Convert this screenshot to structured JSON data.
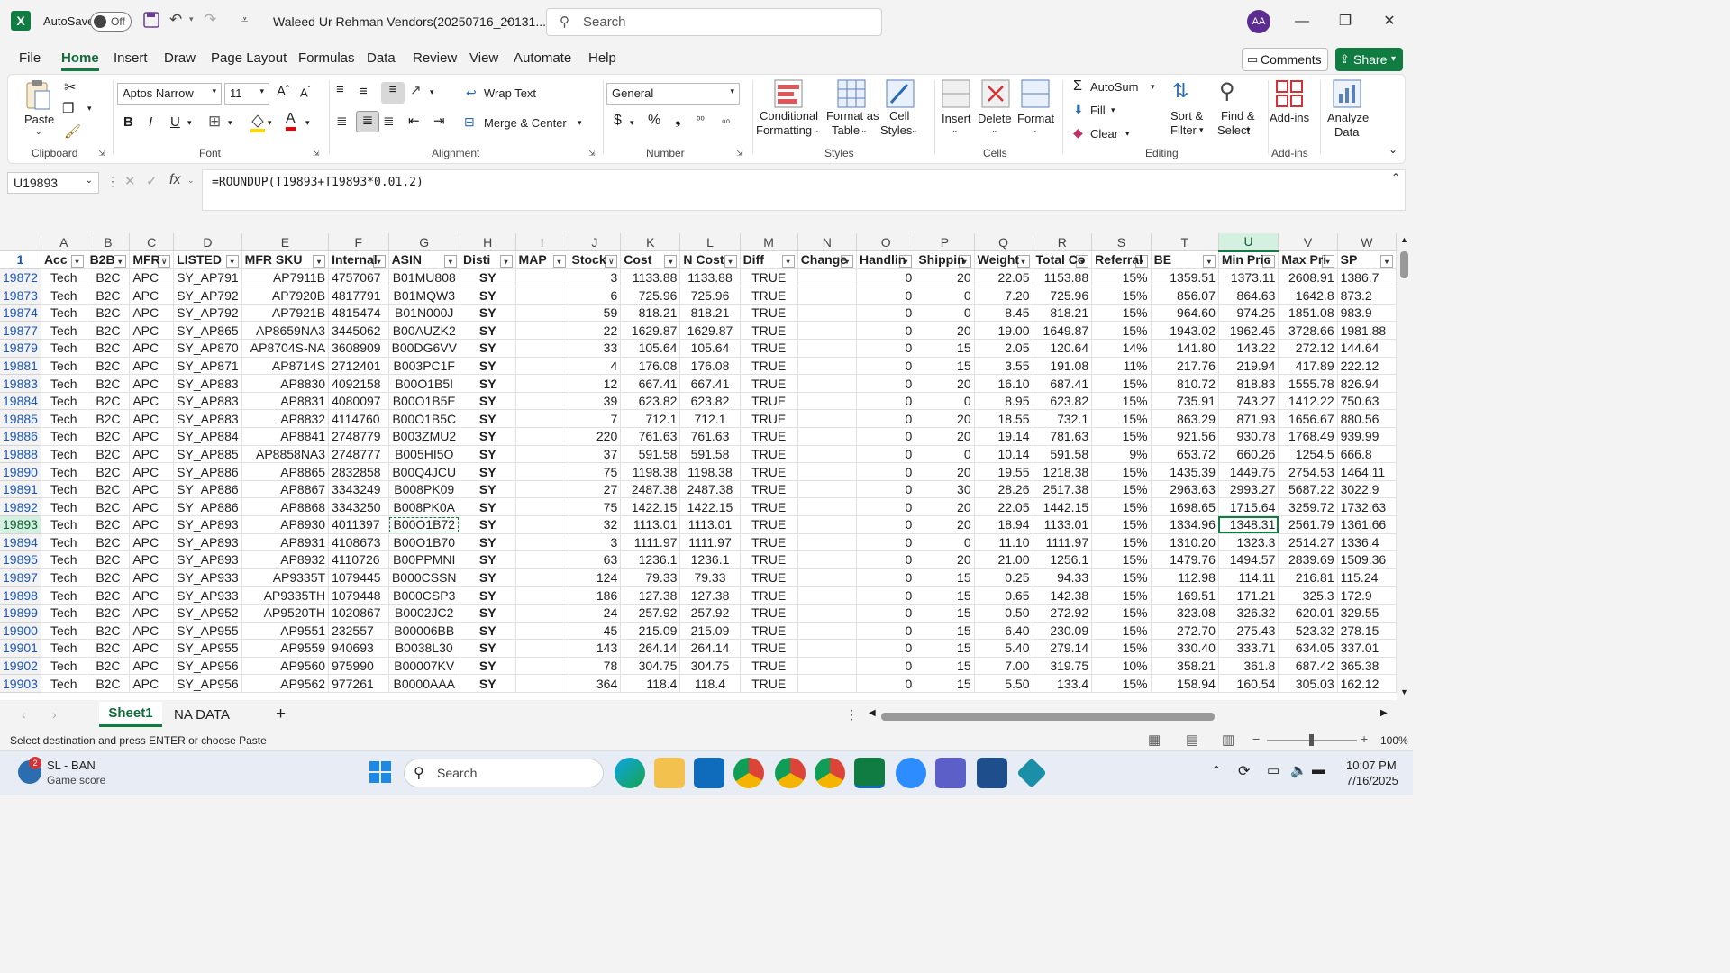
{
  "titlebar": {
    "autosave_label": "AutoSave",
    "autosave_state": "Off",
    "filename": "Waleed Ur Rehman Vendors(20250716_20131...",
    "search_placeholder": "Search",
    "user_initials": "AA"
  },
  "menu": {
    "items": [
      "File",
      "Home",
      "Insert",
      "Draw",
      "Page Layout",
      "Formulas",
      "Data",
      "Review",
      "View",
      "Automate",
      "Help"
    ],
    "comments": "Comments",
    "share": "Share"
  },
  "ribbon": {
    "clipboard": {
      "paste": "Paste",
      "label": "Clipboard"
    },
    "font": {
      "name": "Aptos Narrow",
      "size": "11",
      "label": "Font"
    },
    "alignment": {
      "wrap": "Wrap Text",
      "merge": "Merge & Center",
      "label": "Alignment"
    },
    "number": {
      "format": "General",
      "label": "Number"
    },
    "styles": {
      "conditional": "Conditional",
      "formatting": "Formatting",
      "format_as": "Format as",
      "table": "Table",
      "cell": "Cell",
      "cell_styles": "Styles",
      "label": "Styles"
    },
    "cells": {
      "insert": "Insert",
      "delete": "Delete",
      "format": "Format",
      "label": "Cells"
    },
    "editing": {
      "autosum": "AutoSum",
      "fill": "Fill",
      "clear": "Clear",
      "sort": "Sort &",
      "filter": "Filter",
      "find": "Find &",
      "select": "Select",
      "label": "Editing"
    },
    "addins": {
      "addins": "Add-ins",
      "label": "Add-ins"
    },
    "analyze": {
      "line1": "Analyze",
      "line2": "Data"
    }
  },
  "formula_bar": {
    "cell_ref": "U19893",
    "formula": "=ROUNDUP(T19893+T19893*0.01,2)"
  },
  "columns": [
    "A",
    "B",
    "C",
    "D",
    "E",
    "F",
    "G",
    "H",
    "I",
    "J",
    "K",
    "L",
    "M",
    "N",
    "O",
    "P",
    "Q",
    "R",
    "S",
    "T",
    "U",
    "V",
    "W"
  ],
  "corner_row": "1",
  "headers": [
    "Acc",
    "B2B",
    "MFR",
    "LISTED",
    "MFR SKU",
    "Internal",
    "ASIN",
    "Disti",
    "MAP",
    "Stock",
    "Cost",
    "N Cost",
    "Diff",
    "Change",
    "Handlin",
    "Shippin",
    "Weight",
    "Total Co",
    "Referral",
    "BE",
    "Min Pric",
    "Max Pri",
    "SP"
  ],
  "rows": [
    [
      "19872",
      "Tech",
      "B2C",
      "APC",
      "SY_AP791",
      "AP7911B",
      "4757067",
      "B01MU808",
      "SY",
      "",
      "3",
      "1133.88",
      "1133.88",
      "TRUE",
      "",
      "0",
      "20",
      "22.05",
      "1153.88",
      "15%",
      "1359.51",
      "1373.11",
      "2608.91",
      "1386.7"
    ],
    [
      "19873",
      "Tech",
      "B2C",
      "APC",
      "SY_AP792",
      "AP7920B",
      "4817791",
      "B01MQW3",
      "SY",
      "",
      "6",
      "725.96",
      "725.96",
      "TRUE",
      "",
      "0",
      "0",
      "7.20",
      "725.96",
      "15%",
      "856.07",
      "864.63",
      "1642.8",
      "873.2"
    ],
    [
      "19874",
      "Tech",
      "B2C",
      "APC",
      "SY_AP792",
      "AP7921B",
      "4815474",
      "B01N000J",
      "SY",
      "",
      "59",
      "818.21",
      "818.21",
      "TRUE",
      "",
      "0",
      "0",
      "8.45",
      "818.21",
      "15%",
      "964.60",
      "974.25",
      "1851.08",
      "983.9"
    ],
    [
      "19877",
      "Tech",
      "B2C",
      "APC",
      "SY_AP865",
      "AP8659NA3",
      "3445062",
      "B00AUZK2",
      "SY",
      "",
      "22",
      "1629.87",
      "1629.87",
      "TRUE",
      "",
      "0",
      "20",
      "19.00",
      "1649.87",
      "15%",
      "1943.02",
      "1962.45",
      "3728.66",
      "1981.88"
    ],
    [
      "19879",
      "Tech",
      "B2C",
      "APC",
      "SY_AP870",
      "AP8704S-NA",
      "3608909",
      "B00DG6VV",
      "SY",
      "",
      "33",
      "105.64",
      "105.64",
      "TRUE",
      "",
      "0",
      "15",
      "2.05",
      "120.64",
      "14%",
      "141.80",
      "143.22",
      "272.12",
      "144.64"
    ],
    [
      "19881",
      "Tech",
      "B2C",
      "APC",
      "SY_AP871",
      "AP8714S",
      "2712401",
      "B003PC1F",
      "SY",
      "",
      "4",
      "176.08",
      "176.08",
      "TRUE",
      "",
      "0",
      "15",
      "3.55",
      "191.08",
      "11%",
      "217.76",
      "219.94",
      "417.89",
      "222.12"
    ],
    [
      "19883",
      "Tech",
      "B2C",
      "APC",
      "SY_AP883",
      "AP8830",
      "4092158",
      "B00O1B5I",
      "SY",
      "",
      "12",
      "667.41",
      "667.41",
      "TRUE",
      "",
      "0",
      "20",
      "16.10",
      "687.41",
      "15%",
      "810.72",
      "818.83",
      "1555.78",
      "826.94"
    ],
    [
      "19884",
      "Tech",
      "B2C",
      "APC",
      "SY_AP883",
      "AP8831",
      "4080097",
      "B00O1B5E",
      "SY",
      "",
      "39",
      "623.82",
      "623.82",
      "TRUE",
      "",
      "0",
      "0",
      "8.95",
      "623.82",
      "15%",
      "735.91",
      "743.27",
      "1412.22",
      "750.63"
    ],
    [
      "19885",
      "Tech",
      "B2C",
      "APC",
      "SY_AP883",
      "AP8832",
      "4114760",
      "B00O1B5C",
      "SY",
      "",
      "7",
      "712.1",
      "712.1",
      "TRUE",
      "",
      "0",
      "20",
      "18.55",
      "732.1",
      "15%",
      "863.29",
      "871.93",
      "1656.67",
      "880.56"
    ],
    [
      "19886",
      "Tech",
      "B2C",
      "APC",
      "SY_AP884",
      "AP8841",
      "2748779",
      "B003ZMU2",
      "SY",
      "",
      "220",
      "761.63",
      "761.63",
      "TRUE",
      "",
      "0",
      "20",
      "19.14",
      "781.63",
      "15%",
      "921.56",
      "930.78",
      "1768.49",
      "939.99"
    ],
    [
      "19888",
      "Tech",
      "B2C",
      "APC",
      "SY_AP885",
      "AP8858NA3",
      "2748777",
      "B005HI5O",
      "SY",
      "",
      "37",
      "591.58",
      "591.58",
      "TRUE",
      "",
      "0",
      "0",
      "10.14",
      "591.58",
      "9%",
      "653.72",
      "660.26",
      "1254.5",
      "666.8"
    ],
    [
      "19890",
      "Tech",
      "B2C",
      "APC",
      "SY_AP886",
      "AP8865",
      "2832858",
      "B00Q4JCU",
      "SY",
      "",
      "75",
      "1198.38",
      "1198.38",
      "TRUE",
      "",
      "0",
      "20",
      "19.55",
      "1218.38",
      "15%",
      "1435.39",
      "1449.75",
      "2754.53",
      "1464.11"
    ],
    [
      "19891",
      "Tech",
      "B2C",
      "APC",
      "SY_AP886",
      "AP8867",
      "3343249",
      "B008PK09",
      "SY",
      "",
      "27",
      "2487.38",
      "2487.38",
      "TRUE",
      "",
      "0",
      "30",
      "28.26",
      "2517.38",
      "15%",
      "2963.63",
      "2993.27",
      "5687.22",
      "3022.9"
    ],
    [
      "19892",
      "Tech",
      "B2C",
      "APC",
      "SY_AP886",
      "AP8868",
      "3343250",
      "B008PK0A",
      "SY",
      "",
      "75",
      "1422.15",
      "1422.15",
      "TRUE",
      "",
      "0",
      "20",
      "22.05",
      "1442.15",
      "15%",
      "1698.65",
      "1715.64",
      "3259.72",
      "1732.63"
    ],
    [
      "19893",
      "Tech",
      "B2C",
      "APC",
      "SY_AP893",
      "AP8930",
      "4011397",
      "B00O1B72",
      "SY",
      "",
      "32",
      "1113.01",
      "1113.01",
      "TRUE",
      "",
      "0",
      "20",
      "18.94",
      "1133.01",
      "15%",
      "1334.96",
      "1348.31",
      "2561.79",
      "1361.66"
    ],
    [
      "19894",
      "Tech",
      "B2C",
      "APC",
      "SY_AP893",
      "AP8931",
      "4108673",
      "B00O1B70",
      "SY",
      "",
      "3",
      "1111.97",
      "1111.97",
      "TRUE",
      "",
      "0",
      "0",
      "11.10",
      "1111.97",
      "15%",
      "1310.20",
      "1323.3",
      "2514.27",
      "1336.4"
    ],
    [
      "19895",
      "Tech",
      "B2C",
      "APC",
      "SY_AP893",
      "AP8932",
      "4110726",
      "B00PPMNI",
      "SY",
      "",
      "63",
      "1236.1",
      "1236.1",
      "TRUE",
      "",
      "0",
      "20",
      "21.00",
      "1256.1",
      "15%",
      "1479.76",
      "1494.57",
      "2839.69",
      "1509.36"
    ],
    [
      "19897",
      "Tech",
      "B2C",
      "APC",
      "SY_AP933",
      "AP9335T",
      "1079445",
      "B000CSSN",
      "SY",
      "",
      "124",
      "79.33",
      "79.33",
      "TRUE",
      "",
      "0",
      "15",
      "0.25",
      "94.33",
      "15%",
      "112.98",
      "114.11",
      "216.81",
      "115.24"
    ],
    [
      "19898",
      "Tech",
      "B2C",
      "APC",
      "SY_AP933",
      "AP9335TH",
      "1079448",
      "B000CSP3",
      "SY",
      "",
      "186",
      "127.38",
      "127.38",
      "TRUE",
      "",
      "0",
      "15",
      "0.65",
      "142.38",
      "15%",
      "169.51",
      "171.21",
      "325.3",
      "172.9"
    ],
    [
      "19899",
      "Tech",
      "B2C",
      "APC",
      "SY_AP952",
      "AP9520TH",
      "1020867",
      "B0002JC2",
      "SY",
      "",
      "24",
      "257.92",
      "257.92",
      "TRUE",
      "",
      "0",
      "15",
      "0.50",
      "272.92",
      "15%",
      "323.08",
      "326.32",
      "620.01",
      "329.55"
    ],
    [
      "19900",
      "Tech",
      "B2C",
      "APC",
      "SY_AP955",
      "AP9551",
      "232557",
      "B00006BB",
      "SY",
      "",
      "45",
      "215.09",
      "215.09",
      "TRUE",
      "",
      "0",
      "15",
      "6.40",
      "230.09",
      "15%",
      "272.70",
      "275.43",
      "523.32",
      "278.15"
    ],
    [
      "19901",
      "Tech",
      "B2C",
      "APC",
      "SY_AP955",
      "AP9559",
      "940693",
      "B0038L30",
      "SY",
      "",
      "143",
      "264.14",
      "264.14",
      "TRUE",
      "",
      "0",
      "15",
      "5.40",
      "279.14",
      "15%",
      "330.40",
      "333.71",
      "634.05",
      "337.01"
    ],
    [
      "19902",
      "Tech",
      "B2C",
      "APC",
      "SY_AP956",
      "AP9560",
      "975990",
      "B00007KV",
      "SY",
      "",
      "78",
      "304.75",
      "304.75",
      "TRUE",
      "",
      "0",
      "15",
      "7.00",
      "319.75",
      "10%",
      "358.21",
      "361.8",
      "687.42",
      "365.38"
    ],
    [
      "19903",
      "Tech",
      "B2C",
      "APC",
      "SY_AP956",
      "AP9562",
      "977261",
      "B0000AAA",
      "SY",
      "",
      "364",
      "118.4",
      "118.4",
      "TRUE",
      "",
      "0",
      "15",
      "5.50",
      "133.4",
      "15%",
      "158.94",
      "160.54",
      "305.03",
      "162.12"
    ]
  ],
  "sheets": {
    "active": "Sheet1",
    "other": "NA DATA",
    "add": "+"
  },
  "status": {
    "message": "Select destination and press ENTER or choose Paste",
    "zoom": "100%"
  },
  "taskbar": {
    "weather_title": "SL - BAN",
    "weather_sub": "Game score",
    "badge": "2",
    "search": "Search",
    "time": "10:07 PM",
    "date": "7/16/2025"
  },
  "colors": {
    "excel_green": "#107c41",
    "selection_fill": "#d3f0e0",
    "link_blue": "#1a56b5"
  }
}
